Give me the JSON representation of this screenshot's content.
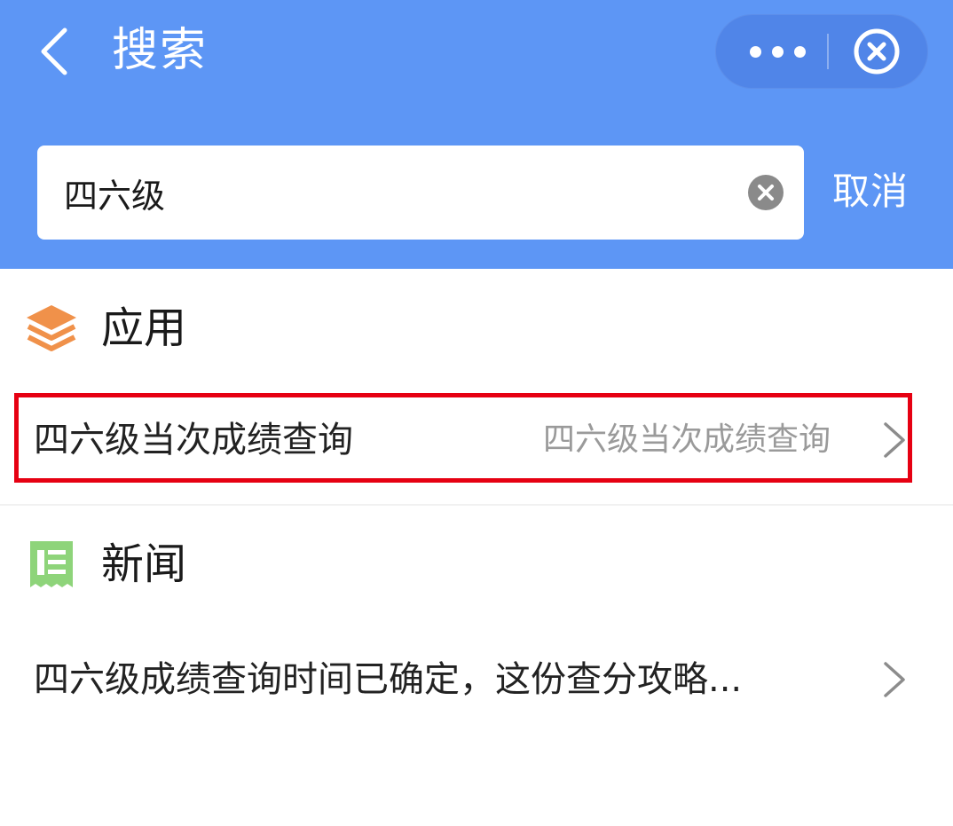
{
  "header": {
    "title": "搜索",
    "back_icon": "chevron-left-icon",
    "more_icon": "more-dots-icon",
    "close_icon": "circle-close-icon",
    "bg_color": "#5d96f5"
  },
  "search": {
    "value": "四六级",
    "clear_icon": "clear-circle-icon",
    "cancel_label": "取消"
  },
  "sections": [
    {
      "title": "应用",
      "icon": "stack-layers-icon",
      "icon_color": "#f0914a",
      "results": [
        {
          "title": "四六级当次成绩查询",
          "subtitle": "四六级当次成绩查询",
          "highlighted": true
        }
      ]
    },
    {
      "title": "新闻",
      "icon": "newspaper-icon",
      "icon_color": "#8ed47a",
      "results": [
        {
          "title": "四六级成绩查询时间已确定，这份查分攻略...",
          "subtitle": "",
          "highlighted": false
        }
      ]
    }
  ],
  "colors": {
    "highlight_border": "#e60012",
    "subtitle_text": "#9a9a9a"
  }
}
